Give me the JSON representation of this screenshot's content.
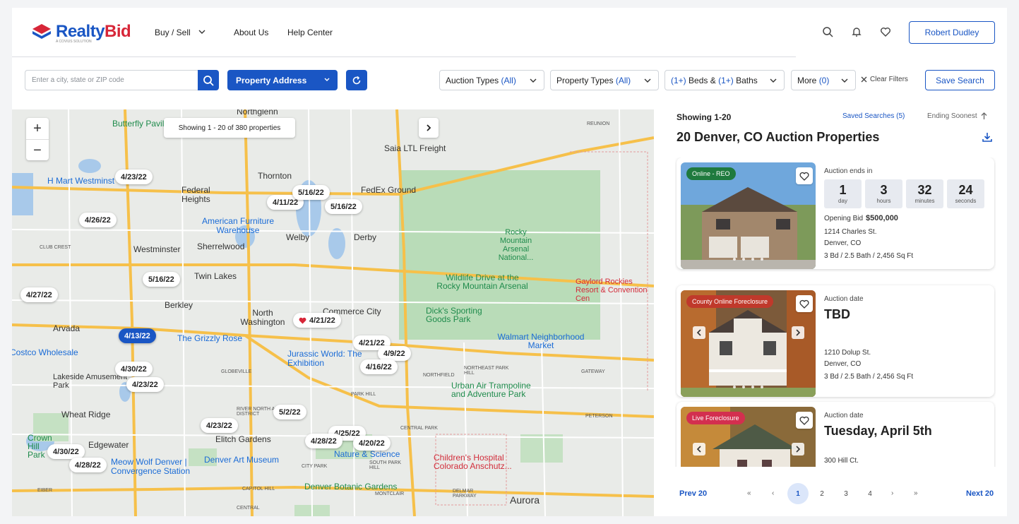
{
  "header": {
    "logo_realty": "Realty",
    "logo_bid": "Bid",
    "logo_sub": "A COVIUS SOLUTION",
    "nav": [
      "Buy / Sell",
      "About Us",
      "Help Center"
    ],
    "user_name": "Robert Dudley"
  },
  "filters": {
    "search_placeholder": "Enter a city, state or ZIP code",
    "address_mode": "Property Address",
    "auction_types": {
      "label": "Auction Types",
      "value": "(All)"
    },
    "property_types": {
      "label": "Property Types",
      "value": "(All)"
    },
    "beds": {
      "beds_value": "(1+)",
      "beds_label": "Beds &",
      "baths_value": "(1+)",
      "baths_label": "Baths"
    },
    "more": {
      "label": "More",
      "value": "(0)"
    },
    "clear": "Clear Filters",
    "save": "Save Search"
  },
  "map": {
    "showing": "Showing 1 - 20 of 380 properties",
    "pins": [
      {
        "label": "4/23/22"
      },
      {
        "label": "4/26/22"
      },
      {
        "label": "4/27/22"
      },
      {
        "label": "4/11/22"
      },
      {
        "label": "5/16/22"
      },
      {
        "label": "5/16/22"
      },
      {
        "label": "5/16/22"
      },
      {
        "label": "4/21/22"
      },
      {
        "label": "4/13/22",
        "active": true
      },
      {
        "label": "4/21/22"
      },
      {
        "label": "4/9/22"
      },
      {
        "label": "4/16/22"
      },
      {
        "label": "4/30/22"
      },
      {
        "label": "4/23/22"
      },
      {
        "label": "5/2/22"
      },
      {
        "label": "4/23/22"
      },
      {
        "label": "4/25/22"
      },
      {
        "label": "4/28/22"
      },
      {
        "label": "4/20/22"
      },
      {
        "label": "4/30/22"
      },
      {
        "label": "4/28/22"
      }
    ],
    "labels": [
      "Northglenn",
      "Butterfly Pavil",
      "Thornton",
      "Federal Heights",
      "H Mart Westminst",
      "American Furniture Warehouse",
      "Welby",
      "Derby",
      "Westminster",
      "Sherrelwood",
      "Twin Lakes",
      "Berkley",
      "North Washington",
      "Commerce City",
      "Arvada",
      "The Grizzly Rose",
      "Jurassic World: The Exhibition",
      "Lakeside Amusement Park",
      "Wheat Ridge",
      "Edgewater",
      "Elitch Gardens",
      "Denver Art Museum",
      "Meow Wolf Denver | Convergence Station",
      "Denver Botanic Gardens",
      "Aurora",
      "Rocky Mountain Arsenal National...",
      "Wildlife Drive at the Rocky Mountain Arsenal",
      "Dick's Sporting Goods Park",
      "Walmart Neighborhood Market",
      "Urban Air Trampoline and Adventure Park",
      "Children's Hospital Colorado Anschutz...",
      "Saia LTL Freight",
      "FedEx Ground",
      "Gaylord Rockies Resort & Convention Cen",
      "Nature & Science",
      "Costco Wholesale",
      "Crown Hill Park",
      "REUNION",
      "CLUB CREST",
      "GLOBEVILLE",
      "NORTHFIELD",
      "NORTHEAST PARK HILL",
      "GATEWAY",
      "PARK HILL",
      "CITY PARK",
      "SOUTH PARK HILL",
      "CAPITOL HILL",
      "MONTCLAIR",
      "DELMAR PARKWAY",
      "PETERSON",
      "EIBER",
      "CENTRAL",
      "CENTRAL PARK",
      "RIVER NORTH ART DISTRICT"
    ]
  },
  "results": {
    "showing": "Showing 1-20",
    "saved_searches": "Saved Searches (5)",
    "sort": "Ending Soonest",
    "title": "20 Denver, CO Auction Properties",
    "cards": [
      {
        "badge": "Online - REO",
        "badge_color": "#1f7a3e",
        "date_label": "Auction ends in",
        "countdown": [
          {
            "num": "1",
            "unit": "day"
          },
          {
            "num": "3",
            "unit": "hours"
          },
          {
            "num": "32",
            "unit": "minutes"
          },
          {
            "num": "24",
            "unit": "seconds"
          }
        ],
        "opening_label": "Opening Bid",
        "opening_value": "$500,000",
        "street": "1214 Charles St.",
        "city": "Denver, CO",
        "details": "3 Bd / 2.5 Bath / 2,456 Sq Ft"
      },
      {
        "badge": "County Online Foreclosure",
        "badge_color": "#c0392b",
        "date_label": "Auction date",
        "date_value": "TBD",
        "street": "1210 Dolup St.",
        "city": "Denver, CO",
        "details": "3 Bd / 2.5 Bath / 2,456 Sq Ft"
      },
      {
        "badge": "Live Foreclosure",
        "badge_color": "#d32f4f",
        "date_label": "Auction date",
        "date_value": "Tuesday, April 5th",
        "street": "300 Hill Ct."
      }
    ]
  },
  "pagination": {
    "prev": "Prev 20",
    "next": "Next 20",
    "first": "«",
    "prev_arrow": "‹",
    "next_arrow": "›",
    "last": "»",
    "pages": [
      "1",
      "2",
      "3",
      "4"
    ],
    "current": "1"
  }
}
